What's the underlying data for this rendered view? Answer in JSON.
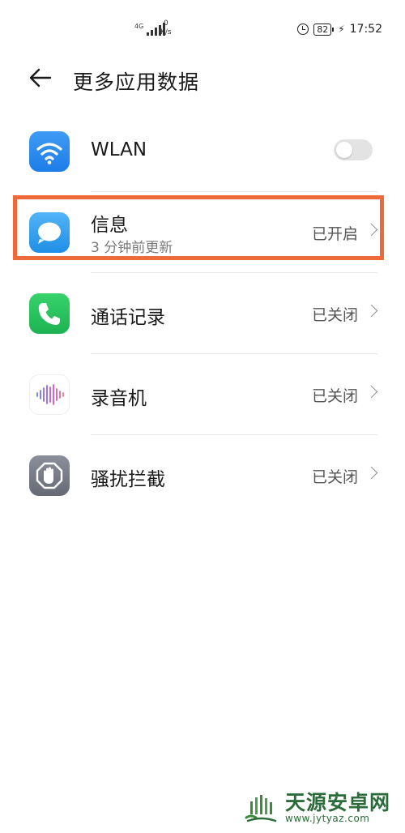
{
  "status_bar": {
    "network": "4G",
    "speed_value": "0",
    "speed_unit": "K/s",
    "battery": "82",
    "time": "17:52"
  },
  "header": {
    "title": "更多应用数据"
  },
  "items": [
    {
      "label": "WLAN",
      "control": "toggle",
      "toggle_on": false,
      "icon": "wifi-icon"
    },
    {
      "label": "信息",
      "subtitle": "3 分钟前更新",
      "status": "已开启",
      "icon": "message-icon",
      "highlighted": true
    },
    {
      "label": "通话记录",
      "status": "已关闭",
      "icon": "phone-icon"
    },
    {
      "label": "录音机",
      "status": "已关闭",
      "icon": "recorder-icon"
    },
    {
      "label": "骚扰拦截",
      "status": "已关闭",
      "icon": "block-hand-icon"
    }
  ],
  "watermark": {
    "name": "天源安卓网",
    "url": "www.jytyaz.com"
  },
  "colors": {
    "highlight": "#ef6a3a",
    "wlan_icon": "#1d7de8",
    "message_icon": "#1f8fe6",
    "phone_icon": "#1db352",
    "block_icon": "#666a74"
  }
}
